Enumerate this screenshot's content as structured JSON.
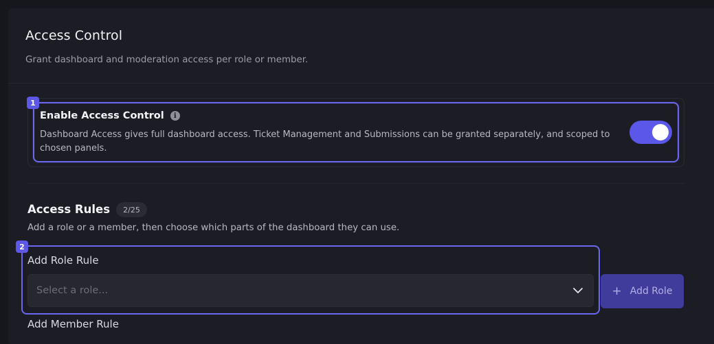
{
  "header": {
    "title": "Access Control",
    "subtitle": "Grant dashboard and moderation access per role or member."
  },
  "access_control": {
    "badge": "1",
    "title": "Enable Access Control",
    "info_icon": "info-icon",
    "description": "Dashboard Access gives full dashboard access. Ticket Management and Submissions can be granted separately, and scoped to chosen panels.",
    "toggle_on": true
  },
  "rules": {
    "title": "Access Rules",
    "count": "2/25",
    "description": "Add a role or a member, then choose which parts of the dashboard they can use."
  },
  "role_rule": {
    "badge": "2",
    "label": "Add Role Rule",
    "select_placeholder": "Select a role...",
    "button_icon": "+",
    "button_label": "Add Role"
  },
  "member_rule": {
    "label": "Add Member Rule"
  },
  "colors": {
    "accent": "#5b57e8",
    "highlight": "#6b67f0",
    "background": "#1c1d24"
  }
}
